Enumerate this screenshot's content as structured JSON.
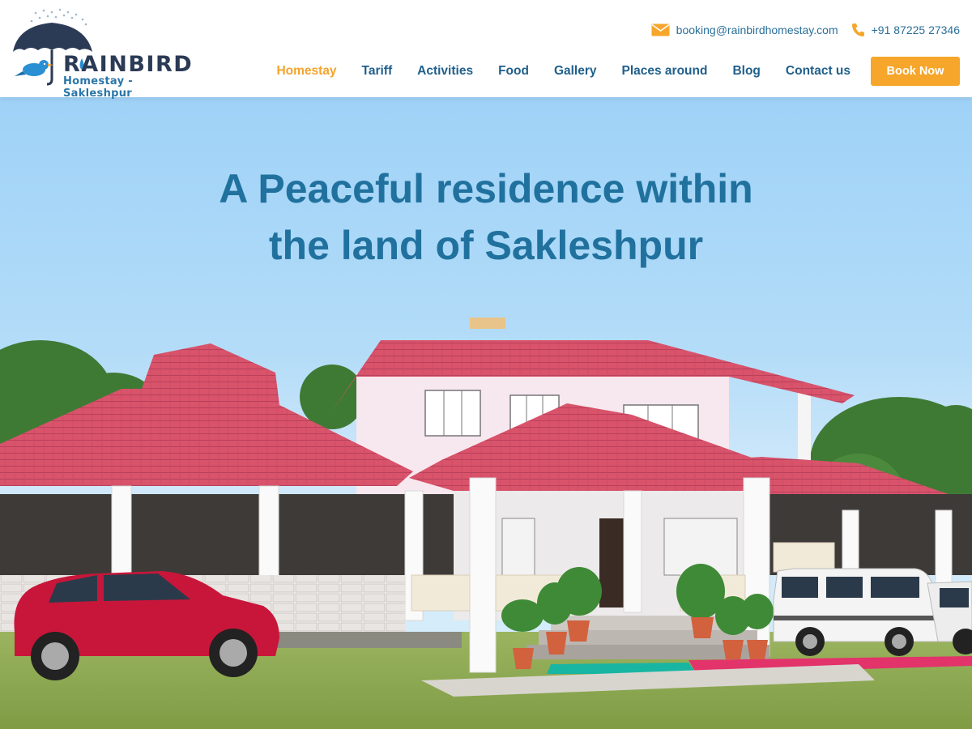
{
  "brand": {
    "name": "RAINBIRD",
    "tagline": "Homestay - Sakleshpur",
    "icons": [
      "umbrella-icon",
      "bird-icon"
    ],
    "colors": {
      "navy": "#2b3a55",
      "blue": "#2a76a8"
    }
  },
  "contact": {
    "email": "booking@rainbirdhomestay.com",
    "phone": "+91 87225 27346",
    "icons": [
      "envelope-icon",
      "phone-icon"
    ]
  },
  "nav": {
    "items": [
      {
        "label": "Homestay",
        "active": true
      },
      {
        "label": "Tariff"
      },
      {
        "label": "Activities"
      },
      {
        "label": "Food"
      },
      {
        "label": "Gallery"
      },
      {
        "label": "Places around"
      },
      {
        "label": "Blog"
      },
      {
        "label": "Contact us"
      }
    ],
    "book_label": "Book Now"
  },
  "hero": {
    "title_line1": "A Peaceful residence within",
    "title_line2": "the land of Sakleshpur"
  },
  "colors": {
    "accent": "#f6a62b",
    "nav_text": "#1f5f8b",
    "hero_title": "#20719e",
    "roof": "#d9536b"
  }
}
